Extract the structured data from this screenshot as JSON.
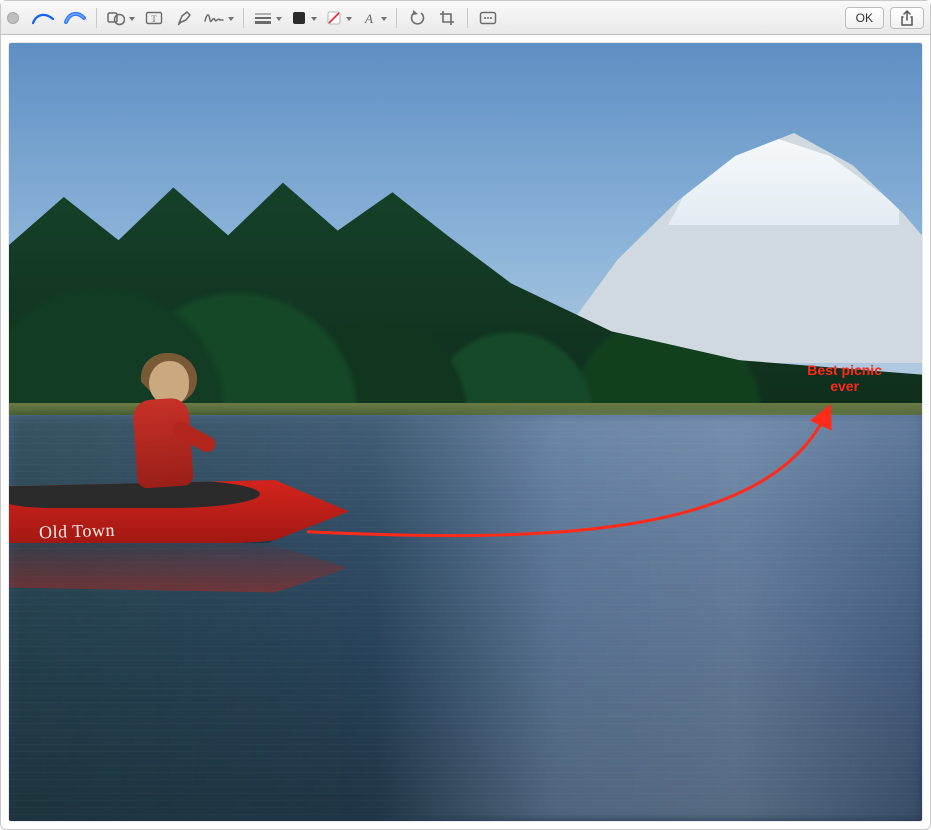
{
  "toolbar": {
    "close_tooltip": "Close",
    "sketch_tooltip": "Sketch",
    "draw_tooltip": "Draw",
    "shapes_tooltip": "Shapes",
    "text_tooltip": "Text",
    "highlight_tooltip": "Highlight",
    "sign_tooltip": "Sign",
    "line_style_tooltip": "Shape Style",
    "border_color_tooltip": "Border Colour",
    "fill_color_tooltip": "Fill Colour",
    "text_style_tooltip": "Text Style",
    "rotate_tooltip": "Rotate Left",
    "crop_tooltip": "Crop",
    "annotate_tooltip": "Annotate",
    "ok_label": "OK",
    "share_tooltip": "Share"
  },
  "photo": {
    "canoe_brand": "Old Town"
  },
  "annotation": {
    "text": "Best picnic\never",
    "color": "#ff2a1a",
    "arrow": {
      "from": "canoe-stern",
      "to": "far-shore-right",
      "stroke_width": 3
    }
  }
}
